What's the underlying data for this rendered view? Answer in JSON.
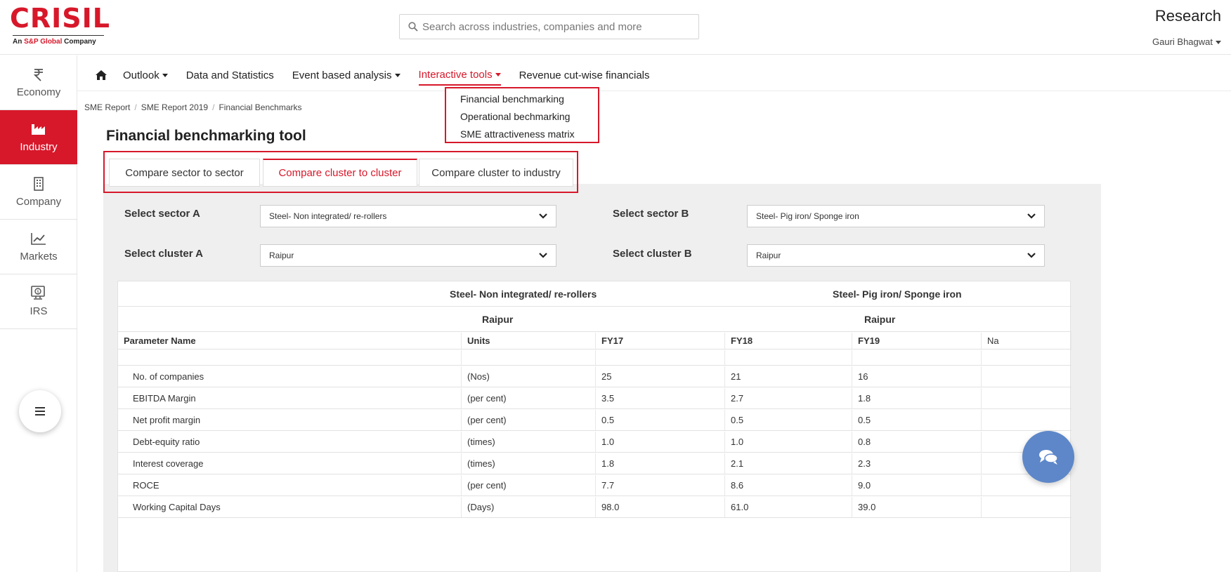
{
  "header": {
    "logo_text": "CRISIL",
    "logo_sub_prefix": "An ",
    "logo_sub_brand": "S&P Global",
    "logo_sub_suffix": " Company",
    "search_placeholder": "Search across industries, companies and more",
    "section_title": "Research",
    "user_name": "Gauri Bhagwat"
  },
  "sidebar": {
    "items": [
      {
        "label": "Economy",
        "icon": "rupee-icon"
      },
      {
        "label": "Industry",
        "icon": "factory-icon",
        "active": true
      },
      {
        "label": "Company",
        "icon": "building-icon"
      },
      {
        "label": "Markets",
        "icon": "chart-line-icon"
      },
      {
        "label": "IRS",
        "icon": "monitor-dollar-icon"
      }
    ]
  },
  "nav": {
    "items": [
      "Outlook",
      "Data and Statistics",
      "Event based analysis",
      "Interactive tools",
      "Revenue cut-wise financials"
    ],
    "active": "Interactive tools",
    "dropdown": [
      "Financial benchmarking",
      "Operational bechmarking",
      "SME attractiveness matrix"
    ]
  },
  "breadcrumb": [
    "SME Report",
    "SME Report 2019",
    "Financial Benchmarks"
  ],
  "page_title": "Financial benchmarking tool",
  "tabs": [
    "Compare sector to sector",
    "Compare cluster to cluster",
    "Compare cluster to industry"
  ],
  "filters": {
    "sector_a_label": "Select sector A",
    "sector_a_value": "Steel- Non integrated/ re-rollers",
    "sector_b_label": "Select sector B",
    "sector_b_value": "Steel- Pig iron/ Sponge iron",
    "cluster_a_label": "Select cluster A",
    "cluster_a_value": "Raipur",
    "cluster_b_label": "Select cluster B",
    "cluster_b_value": "Raipur"
  },
  "table": {
    "group_a_sector": "Steel- Non integrated/ re-rollers",
    "group_b_sector": "Steel- Pig iron/ Sponge iron",
    "group_a_cluster": "Raipur",
    "group_b_cluster": "Raipur",
    "columns": [
      "Parameter Name",
      "Units",
      "FY17",
      "FY18",
      "FY19",
      "Na"
    ],
    "rows": [
      [
        "No. of companies",
        "(Nos)",
        "25",
        "21",
        "16",
        ""
      ],
      [
        "EBITDA Margin",
        "(per cent)",
        "3.5",
        "2.7",
        "1.8",
        ""
      ],
      [
        "Net profit margin",
        "(per cent)",
        "0.5",
        "0.5",
        "0.5",
        ""
      ],
      [
        "Debt-equity ratio",
        "(times)",
        "1.0",
        "1.0",
        "0.8",
        ""
      ],
      [
        "Interest coverage",
        "(times)",
        "1.8",
        "2.1",
        "2.3",
        ""
      ],
      [
        "ROCE",
        "(per cent)",
        "7.7",
        "8.6",
        "9.0",
        ""
      ],
      [
        "Working Capital Days",
        "(Days)",
        "98.0",
        "61.0",
        "39.0",
        ""
      ]
    ]
  },
  "colors": {
    "brand_red": "#d7182a",
    "chat_blue": "#5d87c9"
  }
}
